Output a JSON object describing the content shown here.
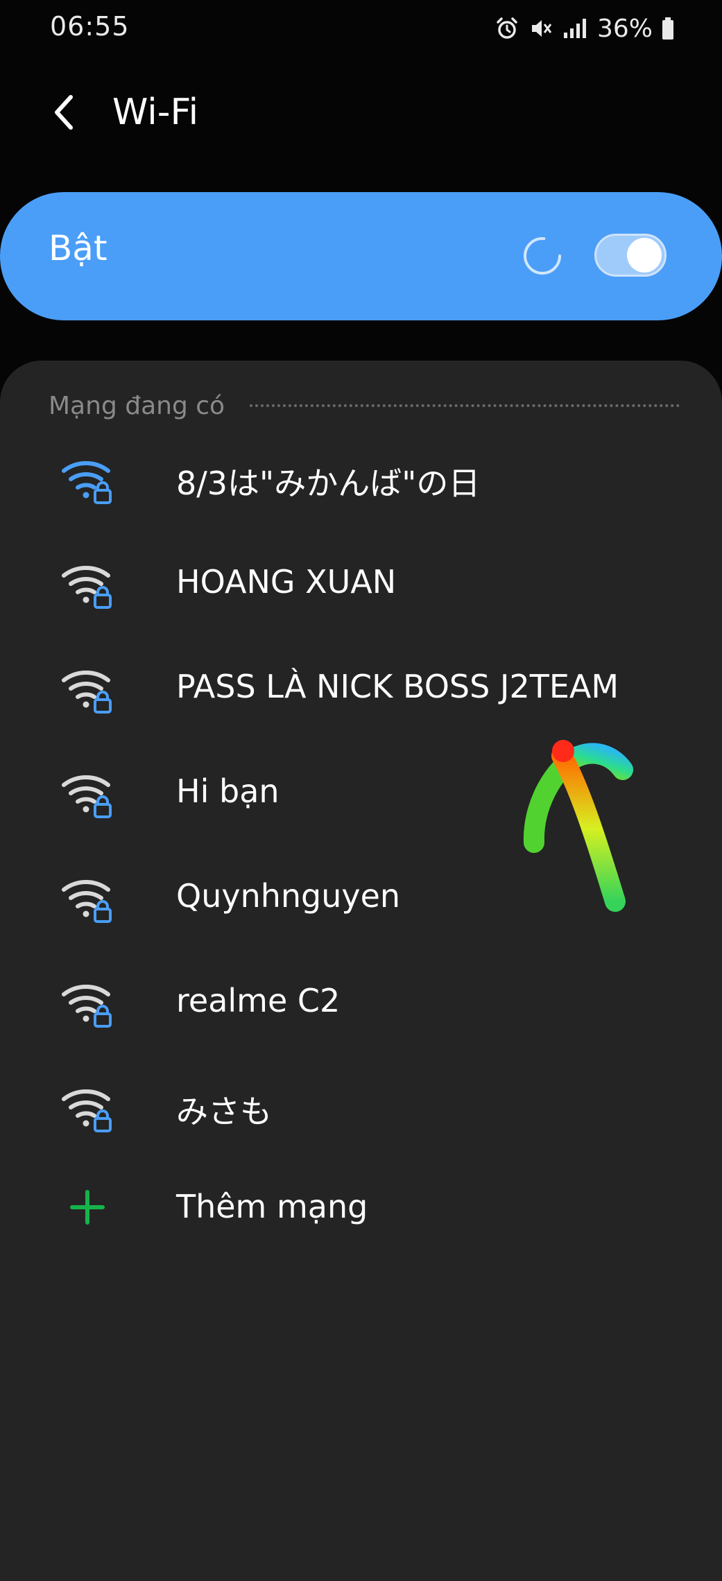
{
  "status_bar": {
    "time": "06:55",
    "battery_percent": "36%",
    "icons": [
      "alarm-icon",
      "mute-icon",
      "signal-icon",
      "battery-icon"
    ]
  },
  "header": {
    "title": "Wi-Fi",
    "back_icon": "chevron-left-icon"
  },
  "master_switch": {
    "label": "Bật",
    "enabled": true,
    "scanning": true
  },
  "available_networks": {
    "section_title": "Mạng đang có",
    "items": [
      {
        "ssid": "8/3は\"みかんば\"の日",
        "secured": true,
        "icon_color": "#4a9ef7"
      },
      {
        "ssid": "HOANG XUAN",
        "secured": true,
        "icon_color": "#d9d9d9"
      },
      {
        "ssid": "PASS LÀ NICK BOSS J2TEAM",
        "secured": true,
        "icon_color": "#d9d9d9"
      },
      {
        "ssid": "Hi bạn",
        "secured": true,
        "icon_color": "#d9d9d9"
      },
      {
        "ssid": "Quynhnguyen",
        "secured": true,
        "icon_color": "#d9d9d9"
      },
      {
        "ssid": "realme C2",
        "secured": true,
        "icon_color": "#d9d9d9"
      },
      {
        "ssid": "みさも",
        "secured": true,
        "icon_color": "#d9d9d9"
      }
    ],
    "add_network_label": "Thêm mạng"
  },
  "colors": {
    "accent": "#4a9ef7",
    "panel": "#242424",
    "background": "#050505",
    "add_icon": "#16b34a",
    "lock": "#4a9ef7"
  }
}
